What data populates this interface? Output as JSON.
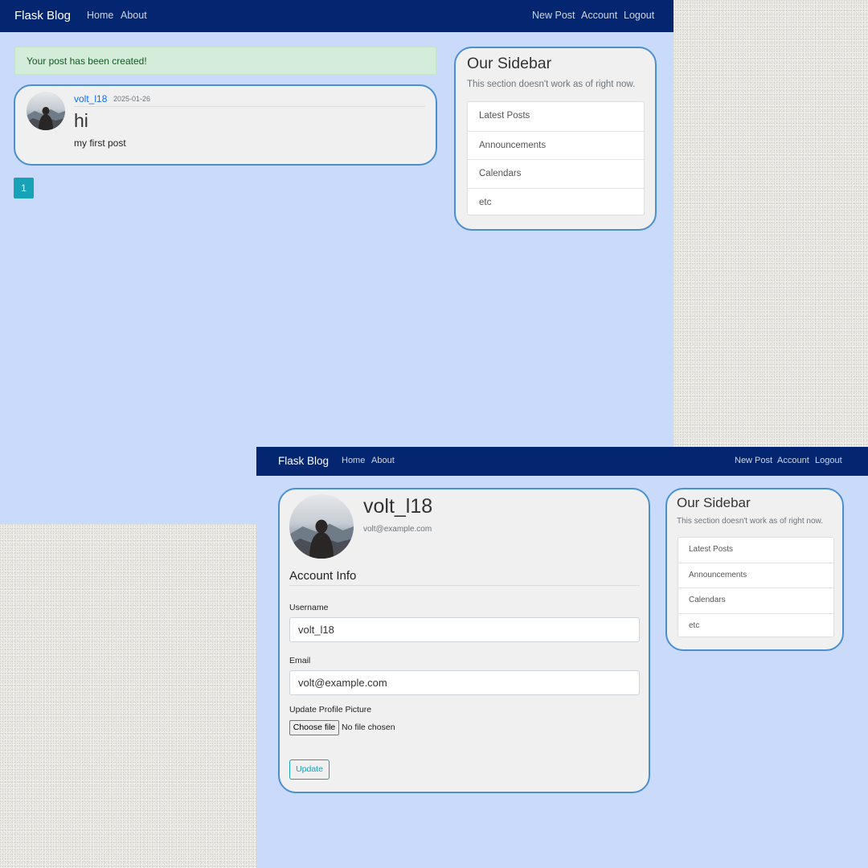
{
  "colors": {
    "navbar": "#042670",
    "page_bg": "#c9dafa",
    "card_border": "#4a8fd0",
    "accent_teal": "#17a2b8",
    "alert_bg": "#d4edda",
    "link": "#0d6efd"
  },
  "home": {
    "navbar": {
      "brand": "Flask Blog",
      "left_links": [
        "Home",
        "About"
      ],
      "right_links": [
        "New Post",
        "Account",
        "Logout"
      ]
    },
    "alert": "Your post has been created!",
    "post": {
      "author": "volt_l18",
      "date": "2025-01-26",
      "title": "hi",
      "content": "my first post",
      "avatar_icon": "profile-avatar"
    },
    "pagination": {
      "current": "1"
    },
    "sidebar": {
      "title": "Our Sidebar",
      "description": "This section doesn't work as of right now.",
      "items": [
        "Latest Posts",
        "Announcements",
        "Calendars",
        "etc"
      ]
    }
  },
  "account": {
    "navbar": {
      "brand": "Flask Blog",
      "left_links": [
        "Home",
        "About"
      ],
      "right_links": [
        "New Post",
        "Account",
        "Logout"
      ]
    },
    "profile": {
      "username": "volt_l18",
      "email": "volt@example.com",
      "avatar_icon": "profile-avatar"
    },
    "form": {
      "legend": "Account Info",
      "username_label": "Username",
      "username_value": "volt_l18",
      "email_label": "Email",
      "email_value": "volt@example.com",
      "picture_label": "Update Profile Picture",
      "file_button": "Choose file",
      "file_status": "No file chosen",
      "submit_label": "Update"
    },
    "sidebar": {
      "title": "Our Sidebar",
      "description": "This section doesn't work as of right now.",
      "items": [
        "Latest Posts",
        "Announcements",
        "Calendars",
        "etc"
      ]
    }
  }
}
